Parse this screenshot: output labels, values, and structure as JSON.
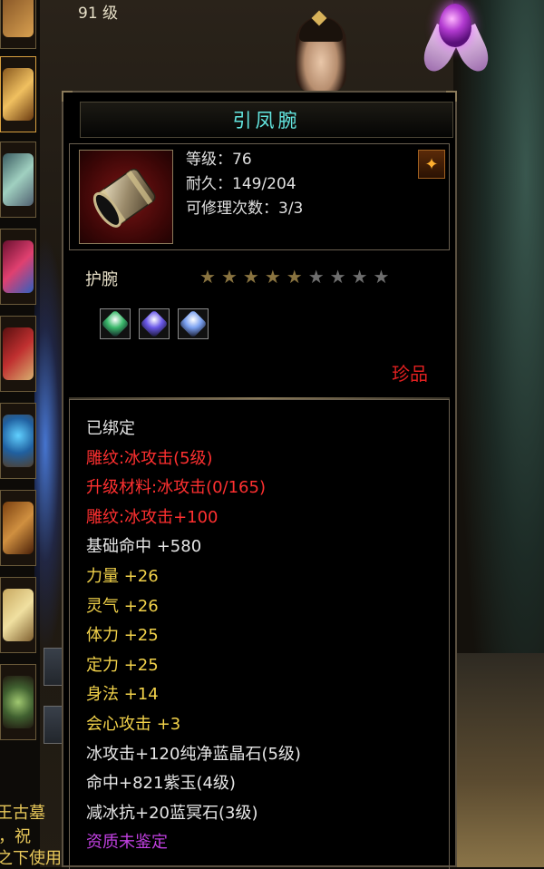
{
  "header": {
    "level_text": "91 级"
  },
  "item": {
    "name": "引凤腕",
    "stats": [
      "等级：76",
      "耐久：149/204",
      "可修理次数：3/3"
    ],
    "type": "护腕",
    "stars": {
      "filled": 5,
      "total": 9
    },
    "gems": [
      {
        "name": "green-gem",
        "color": "#3ab86a"
      },
      {
        "name": "purple-gem",
        "color": "#6a58e8"
      },
      {
        "name": "blue-gem",
        "color": "#7aa0f0"
      }
    ],
    "rarity": "珍品",
    "attributes": [
      {
        "text": "已绑定",
        "style": "c-bound"
      },
      {
        "text": "雕纹:冰攻击(5级)",
        "style": "c-red"
      },
      {
        "text": "升级材料:冰攻击(0/165)",
        "style": "c-red"
      },
      {
        "text": "雕纹:冰攻击+100",
        "style": "c-red"
      },
      {
        "text": "基础命中 +580",
        "style": "c-white"
      },
      {
        "text": "力量 +26",
        "style": "c-yellow"
      },
      {
        "text": "灵气 +26",
        "style": "c-yellow"
      },
      {
        "text": "体力 +25",
        "style": "c-yellow"
      },
      {
        "text": "定力 +25",
        "style": "c-yellow"
      },
      {
        "text": "身法 +14",
        "style": "c-yellow"
      },
      {
        "text": "会心攻击 +3",
        "style": "c-yellow"
      },
      {
        "text": "冰攻击+120纯净蓝晶石(5级)",
        "style": "c-white"
      },
      {
        "text": "命中+821紫玉(4级)",
        "style": "c-white"
      },
      {
        "text": "减冰抗+20蓝冥石(3级)",
        "style": "c-white"
      },
      {
        "text": "资质未鉴定",
        "style": "c-purple"
      }
    ]
  },
  "background_text": {
    "line1": "王古墓",
    "line2": "，祝",
    "line3": "之下使用"
  },
  "colors": {
    "item_name": "#63e6e0",
    "rarity": "#e02020",
    "red_attr": "#ff3030",
    "yellow_attr": "#f2d24a",
    "purple_attr": "#c040e0"
  }
}
